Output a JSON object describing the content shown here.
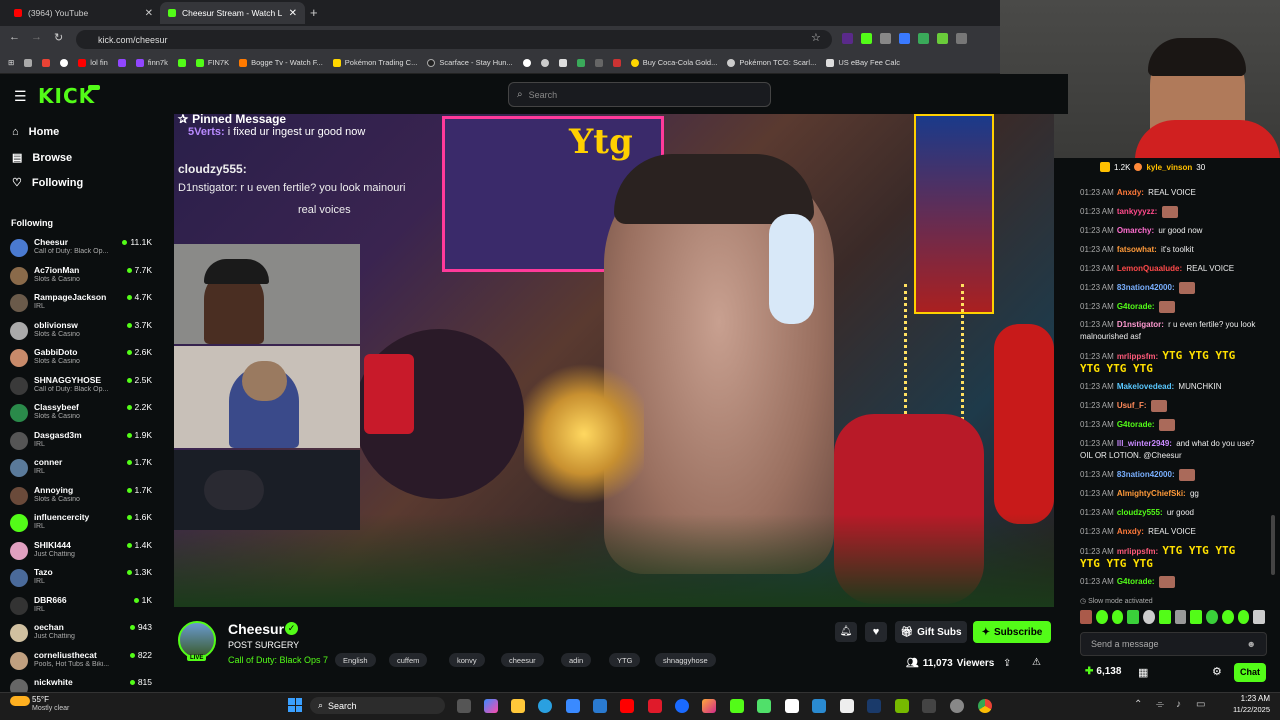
{
  "browser": {
    "tabs": [
      {
        "label": "(3964) YouTube",
        "active": false
      },
      {
        "label": "Cheesur Stream - Watch Li...",
        "active": true
      }
    ],
    "url": "kick.com/cheesur",
    "bookmarks": [
      "lol fin",
      "finn7k",
      "FIN7K",
      "Bogge Tv - Watch F...",
      "Pokémon Trading C...",
      "Scarface - Stay Hun...",
      "Buy Coca-Cola Gold...",
      "Pokémon TCG: Scarl...",
      "US eBay Fee Calc"
    ]
  },
  "header": {
    "logo": "KICK",
    "search_placeholder": "Search"
  },
  "nav": {
    "home": "Home",
    "browse": "Browse",
    "following": "Following"
  },
  "sidebar": {
    "heading": "Following",
    "channels": [
      {
        "name": "Cheesur",
        "category": "Call of Duty: Black Op...",
        "viewers": "11.1K"
      },
      {
        "name": "Ac7ionMan",
        "category": "Slots & Casino",
        "viewers": "7.7K"
      },
      {
        "name": "RampageJackson",
        "category": "IRL",
        "viewers": "4.7K"
      },
      {
        "name": "oblivionsw",
        "category": "Slots & Casino",
        "viewers": "3.7K"
      },
      {
        "name": "GabbiDoto",
        "category": "Slots & Casino",
        "viewers": "2.6K"
      },
      {
        "name": "SHNAGGYHOSE",
        "category": "Call of Duty: Black Op...",
        "viewers": "2.5K"
      },
      {
        "name": "Classybeef",
        "category": "Slots & Casino",
        "viewers": "2.2K"
      },
      {
        "name": "Dasgasd3m",
        "category": "IRL",
        "viewers": "1.9K"
      },
      {
        "name": "conner",
        "category": "IRL",
        "viewers": "1.7K"
      },
      {
        "name": "Annoying",
        "category": "Slots & Casino",
        "viewers": "1.7K"
      },
      {
        "name": "influencercity",
        "category": "IRL",
        "viewers": "1.6K"
      },
      {
        "name": "SHIKI444",
        "category": "Just Chatting",
        "viewers": "1.4K"
      },
      {
        "name": "Tazo",
        "category": "IRL",
        "viewers": "1.3K"
      },
      {
        "name": "DBR666",
        "category": "IRL",
        "viewers": "1K"
      },
      {
        "name": "oechan",
        "category": "Just Chatting",
        "viewers": "943"
      },
      {
        "name": "corneliusthecat",
        "category": "Pools, Hot Tubs & Biki...",
        "viewers": "822"
      },
      {
        "name": "nickwhite",
        "category": "",
        "viewers": "815"
      }
    ]
  },
  "overlay": {
    "pinned_title": "Pinned Message",
    "pinned_user": "5Verts:",
    "pinned_text": "i fixed ur ingest ur good now",
    "line1": "cloudzy555:",
    "line2": "D1nstigator: r u even fertile? you look mainouri",
    "line3": "real voices"
  },
  "stream": {
    "title": "Cheesur",
    "subtitle": "POST SURGERY",
    "category": "Call of Duty: Black Ops 7",
    "tags": [
      "English",
      "cuffem",
      "konvy",
      "cheesur",
      "adin",
      "YTG",
      "shnaggyhose"
    ],
    "viewers": "11,073",
    "viewers_label": "Viewers",
    "gift_label": "Gift Subs",
    "subscribe_label": "Subscribe",
    "live_badge": "LIVE"
  },
  "chat": {
    "top_gifter_count": "1.2K",
    "top_user": "kyle_vinson",
    "top_user_count": "30",
    "messages": [
      {
        "time": "01:23 AM",
        "user": "Anxdy:",
        "text": "REAL VOICE",
        "color": "#ff7a3a"
      },
      {
        "time": "01:23 AM",
        "user": "tankyyyzz:",
        "text": "",
        "color": "#ff4a8a"
      },
      {
        "time": "01:23 AM",
        "user": "Omarchy:",
        "text": "ur good now",
        "color": "#ff6fd0"
      },
      {
        "time": "01:23 AM",
        "user": "fatsowhat:",
        "text": "it's toolkit",
        "color": "#ff9a3a"
      },
      {
        "time": "01:23 AM",
        "user": "LemonQuaalude:",
        "text": "REAL VOICE",
        "color": "#ff4a4a"
      },
      {
        "time": "01:23 AM",
        "user": "83nation42000:",
        "text": "",
        "color": "#7ab0ff"
      },
      {
        "time": "01:23 AM",
        "user": "G4torade:",
        "text": "",
        "color": "#53fc18"
      },
      {
        "time": "01:23 AM",
        "user": "D1nstigator:",
        "text": "r u even fertile? you look malnourished asf",
        "color": "#ff9ad0"
      },
      {
        "time": "01:23 AM",
        "user": "mrlippsfm:",
        "text": "YTG YTG YTG YTG YTG YTG",
        "color": "#ff5a7a"
      },
      {
        "time": "01:23 AM",
        "user": "Makelovedead:",
        "text": "MUNCHKIN",
        "color": "#5ac8ff"
      },
      {
        "time": "01:23 AM",
        "user": "Usuf_F:",
        "text": "",
        "color": "#ff8a5a"
      },
      {
        "time": "01:23 AM",
        "user": "G4torade:",
        "text": "",
        "color": "#53fc18"
      },
      {
        "time": "01:23 AM",
        "user": "lll_winter2949:",
        "text": "and what do you use? OIL OR LOTION. @Cheesur",
        "color": "#c98aff"
      },
      {
        "time": "01:23 AM",
        "user": "83nation42000:",
        "text": "",
        "color": "#7ab0ff"
      },
      {
        "time": "01:23 AM",
        "user": "AlmightyChiefSki:",
        "text": "gg",
        "color": "#ff9a3a"
      },
      {
        "time": "01:23 AM",
        "user": "cloudzy555:",
        "text": "ur good",
        "color": "#53fc18"
      },
      {
        "time": "01:23 AM",
        "user": "Anxdy:",
        "text": "REAL VOICE",
        "color": "#ff7a3a"
      },
      {
        "time": "01:23 AM",
        "user": "mrlippsfm:",
        "text": "YTG YTG YTG YTG YTG YTG",
        "color": "#ff5a7a"
      },
      {
        "time": "01:23 AM",
        "user": "G4torade:",
        "text": "",
        "color": "#53fc18"
      }
    ],
    "slow_mode": "Slow mode activated",
    "input_placeholder": "Send a message",
    "points": "6,138",
    "chat_button": "Chat"
  },
  "taskbar": {
    "temp": "55°F",
    "weather": "Mostly clear",
    "search": "Search",
    "time": "1:23 AM",
    "date": "11/22/2025"
  },
  "colors": {
    "accent": "#53fc18",
    "bg": "#0b0e0f"
  }
}
